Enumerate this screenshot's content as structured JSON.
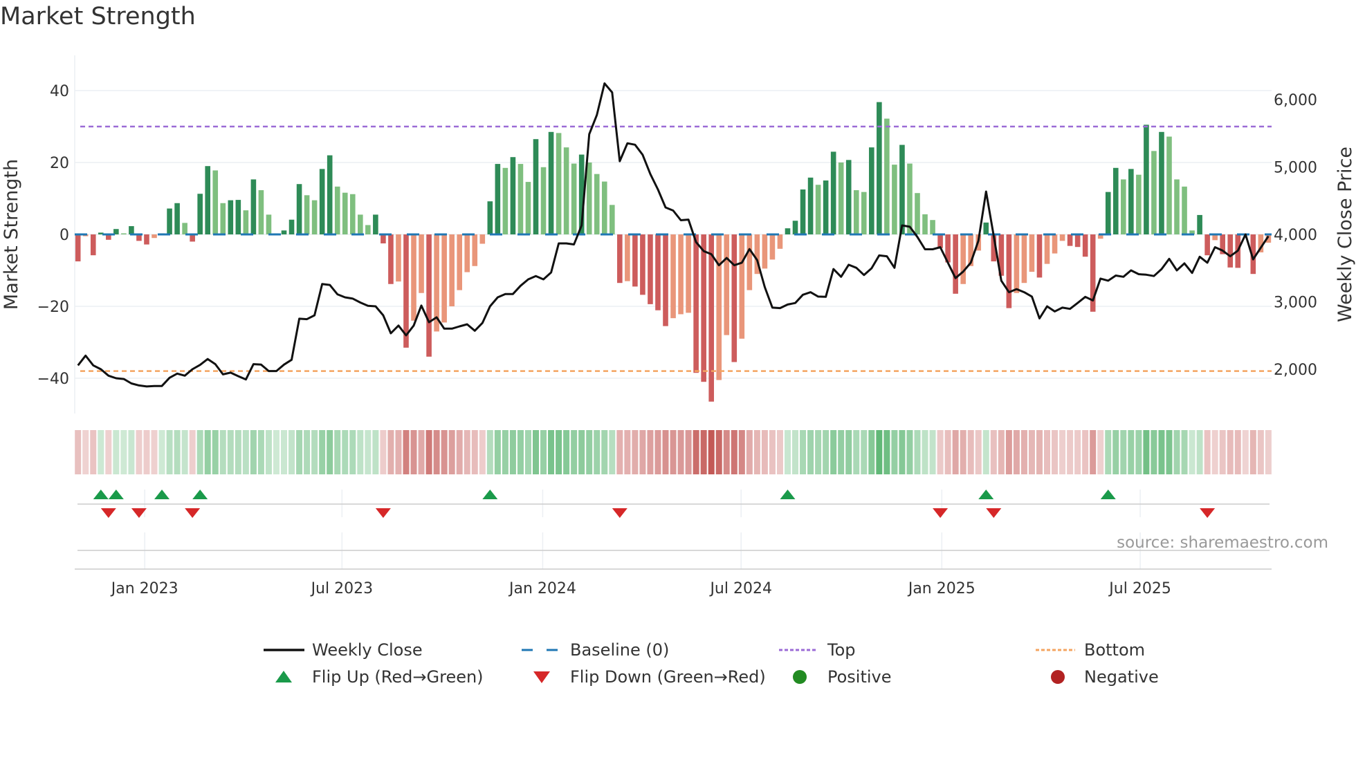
{
  "title": "Market Strength",
  "source": "source: sharemaestro.com",
  "chart_data": {
    "type": "bar+line",
    "title": "Market Strength",
    "ylabel_left": "Market Strength",
    "ylabel_right": "Weekly Close Price",
    "start_week": "2022-11-04",
    "frequency": "weekly",
    "ylim_left": [
      -50,
      50
    ],
    "ylim_right": [
      1500,
      6500
    ],
    "yticks_left": [
      {
        "v": 40,
        "label": "40"
      },
      {
        "v": 20,
        "label": "20"
      },
      {
        "v": 0,
        "label": "0"
      },
      {
        "v": -20,
        "label": "−20"
      },
      {
        "v": -40,
        "label": "−40"
      }
    ],
    "yticks_right": [
      {
        "v": 6000,
        "label": "6,000"
      },
      {
        "v": 5000,
        "label": "5,000"
      },
      {
        "v": 4000,
        "label": "4,000"
      },
      {
        "v": 3000,
        "label": "3,000"
      },
      {
        "v": 2000,
        "label": "2,000"
      }
    ],
    "xticks": [
      {
        "week": 8.75,
        "label": "Jan 2023"
      },
      {
        "week": 34.6,
        "label": "Jul 2023"
      },
      {
        "week": 60.9,
        "label": "Jan 2024"
      },
      {
        "week": 86.9,
        "label": "Jul 2024"
      },
      {
        "week": 113.2,
        "label": "Jan 2025"
      },
      {
        "week": 139.2,
        "label": "Jul 2025"
      }
    ],
    "top_level": 30,
    "bottom_level": -38,
    "baseline": 0,
    "colors": {
      "strong_pos": "#2e8b57",
      "weak_pos": "#7fbf7f",
      "strong_neg": "#cd5c5c",
      "weak_neg": "#e9967a",
      "close": "#111111",
      "top": "#9b6bd6",
      "bottom": "#f4a460",
      "baseline": "#1f77b4",
      "flip_up": "#1a9a4a",
      "flip_down": "#d62728",
      "positive": "#228b22",
      "negative": "#b22222"
    },
    "strength": [
      -7.5,
      -0.5,
      -5.8,
      0.5,
      -1.5,
      1.5,
      0.3,
      2.3,
      -1.8,
      -2.8,
      -1,
      0.3,
      7.2,
      8.7,
      3.2,
      -2,
      11.3,
      19,
      17.8,
      8.7,
      9.5,
      9.6,
      6.7,
      15.3,
      12.3,
      5.5,
      0.3,
      1.1,
      4.1,
      14,
      10.9,
      9.5,
      18.2,
      22,
      13.3,
      11.6,
      11.2,
      5.5,
      2.6,
      5.5,
      -2.5,
      -13.8,
      -13.1,
      -31.5,
      -24,
      -16.3,
      -34,
      -27,
      -24.5,
      -20,
      -15.5,
      -10.5,
      -8.8,
      -2.6,
      9.2,
      19.6,
      18.5,
      21.5,
      19.6,
      14.6,
      26.5,
      18.7,
      28.5,
      28.2,
      24.2,
      19.7,
      22.2,
      20,
      16.8,
      14.7,
      8.2,
      -13.5,
      -13,
      -14.5,
      -16.8,
      -19.4,
      -21.1,
      -25.5,
      -23.3,
      -22.2,
      -21.8,
      -38.5,
      -41,
      -46.5,
      -40.5,
      -28,
      -35.5,
      -29,
      -15.5,
      -11,
      -9.5,
      -7,
      -4,
      1.7,
      3.8,
      12.5,
      15.8,
      13.8,
      15,
      23,
      20,
      20.7,
      12.3,
      11.8,
      24.2,
      36.8,
      32.2,
      19.4,
      24.9,
      19.7,
      11.5,
      5.6,
      4,
      -3.8,
      -7.8,
      -16.5,
      -13.8,
      -8.8,
      -4.5,
      3.3,
      -7.5,
      -11.5,
      -20.5,
      -16.3,
      -13.5,
      -10.4,
      -12,
      -8.2,
      -5.3,
      -1.8,
      -3.2,
      -3.5,
      -6.2,
      -21.5,
      -1.2,
      11.8,
      18.5,
      15.3,
      18.2,
      16.6,
      30.5,
      23.2,
      28.5,
      27.2,
      15.3,
      13.3,
      1.1,
      5.4,
      -5.8,
      -1.6,
      -5.5,
      -9.2,
      -9.3,
      -0.3,
      -11,
      -5,
      -2.3
    ],
    "weekly_close": [
      2057,
      2202,
      2057,
      2000,
      1905,
      1867,
      1855,
      1790,
      1760,
      1745,
      1752,
      1752,
      1874,
      1935,
      1905,
      2000,
      2065,
      2152,
      2076,
      1924,
      1950,
      1897,
      1848,
      2076,
      2069,
      1973,
      1973,
      2069,
      2141,
      2750,
      2743,
      2800,
      3265,
      3250,
      3112,
      3067,
      3048,
      2990,
      2941,
      2933,
      2800,
      2533,
      2648,
      2503,
      2648,
      2945,
      2697,
      2770,
      2602,
      2602,
      2636,
      2667,
      2571,
      2686,
      2933,
      3067,
      3116,
      3116,
      3238,
      3333,
      3383,
      3333,
      3436,
      3867,
      3867,
      3851,
      4133,
      5486,
      5771,
      6240,
      6107,
      5086,
      5352,
      5330,
      5181,
      4895,
      4667,
      4400,
      4354,
      4210,
      4220,
      3886,
      3752,
      3707,
      3543,
      3650,
      3543,
      3581,
      3783,
      3619,
      3219,
      2914,
      2907,
      2960,
      2983,
      3105,
      3143,
      3078,
      3074,
      3486,
      3371,
      3550,
      3505,
      3398,
      3497,
      3688,
      3676,
      3505,
      4133,
      4114,
      3962,
      3779,
      3779,
      3810,
      3581,
      3352,
      3448,
      3581,
      3905,
      4636,
      3981,
      3314,
      3143,
      3189,
      3143,
      3078,
      2754,
      2933,
      2857,
      2914,
      2895,
      2983,
      3074,
      3021,
      3345,
      3314,
      3390,
      3371,
      3467,
      3410,
      3402,
      3383,
      3486,
      3638,
      3467,
      3570,
      3429,
      3669,
      3581,
      3810,
      3760,
      3676,
      3760,
      4000,
      3630,
      3802,
      3973
    ],
    "flip_up_weeks": [
      3,
      5,
      11,
      16,
      54,
      93,
      119,
      135
    ],
    "flip_down_weeks": [
      4,
      8,
      15,
      40,
      71,
      113,
      120,
      148
    ],
    "legend": {
      "placement": "bottom",
      "items": [
        {
          "label": "Weekly Close",
          "kind": "line"
        },
        {
          "label": "Baseline (0)",
          "kind": "baseline"
        },
        {
          "label": "Top",
          "kind": "top"
        },
        {
          "label": "Bottom",
          "kind": "bottom"
        },
        {
          "label": "Flip Up (Red→Green)",
          "kind": "flip_up"
        },
        {
          "label": "Flip Down (Green→Red)",
          "kind": "flip_down"
        },
        {
          "label": "Positive",
          "kind": "positive"
        },
        {
          "label": "Negative",
          "kind": "negative"
        }
      ]
    }
  }
}
